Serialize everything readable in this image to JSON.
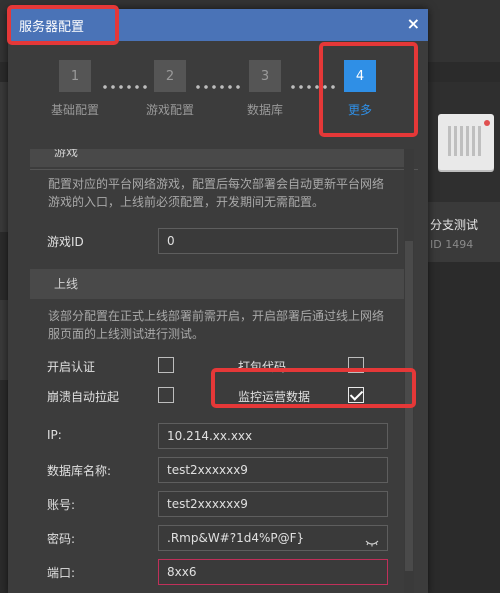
{
  "dialog": {
    "title": "服务器配置",
    "close_icon": "×"
  },
  "stepper": {
    "steps": [
      {
        "num": "1",
        "label": "基础配置"
      },
      {
        "num": "2",
        "label": "游戏配置"
      },
      {
        "num": "3",
        "label": "数据库"
      },
      {
        "num": "4",
        "label": "更多"
      }
    ],
    "active_step": 4,
    "accent": "#2f8fe6"
  },
  "game_section": {
    "title": "游戏",
    "desc": "配置对应的平台网络游戏，配置后每次部署会自动更新平台网络游戏的入口，上线前必须配置，开发期间无需配置。",
    "game_id_label": "游戏ID",
    "game_id_value": "0"
  },
  "online_section": {
    "title": "上线",
    "desc": "该部分配置在正式上线部署前需开启，开启部署后通过线上网络服页面的上线测试进行测试。",
    "checks": {
      "enable_auth": {
        "label": "开启认证",
        "checked": false
      },
      "pack_code": {
        "label": "打包代码",
        "checked": false
      },
      "crash_restart": {
        "label": "崩溃自动拉起",
        "checked": false
      },
      "monitor_data": {
        "label": "监控运营数据",
        "checked": true
      }
    },
    "fields": {
      "ip": {
        "label": "IP:",
        "value": "10.214.xx.xxx"
      },
      "db_name": {
        "label": "数据库名称:",
        "value": "test2xxxxxx9"
      },
      "account": {
        "label": "账号:",
        "value": "test2xxxxxx9"
      },
      "password": {
        "label": "密码:",
        "value": ".Rmp&W#?1d4%P@F}"
      },
      "port": {
        "label": "端口:",
        "value": "8xx6"
      }
    }
  },
  "background": {
    "card_title": "分支测试",
    "card_id": "ID 1494"
  },
  "colors": {
    "header": "#4a73b7",
    "highlight": "#e53838",
    "error_border": "#c0305a"
  }
}
